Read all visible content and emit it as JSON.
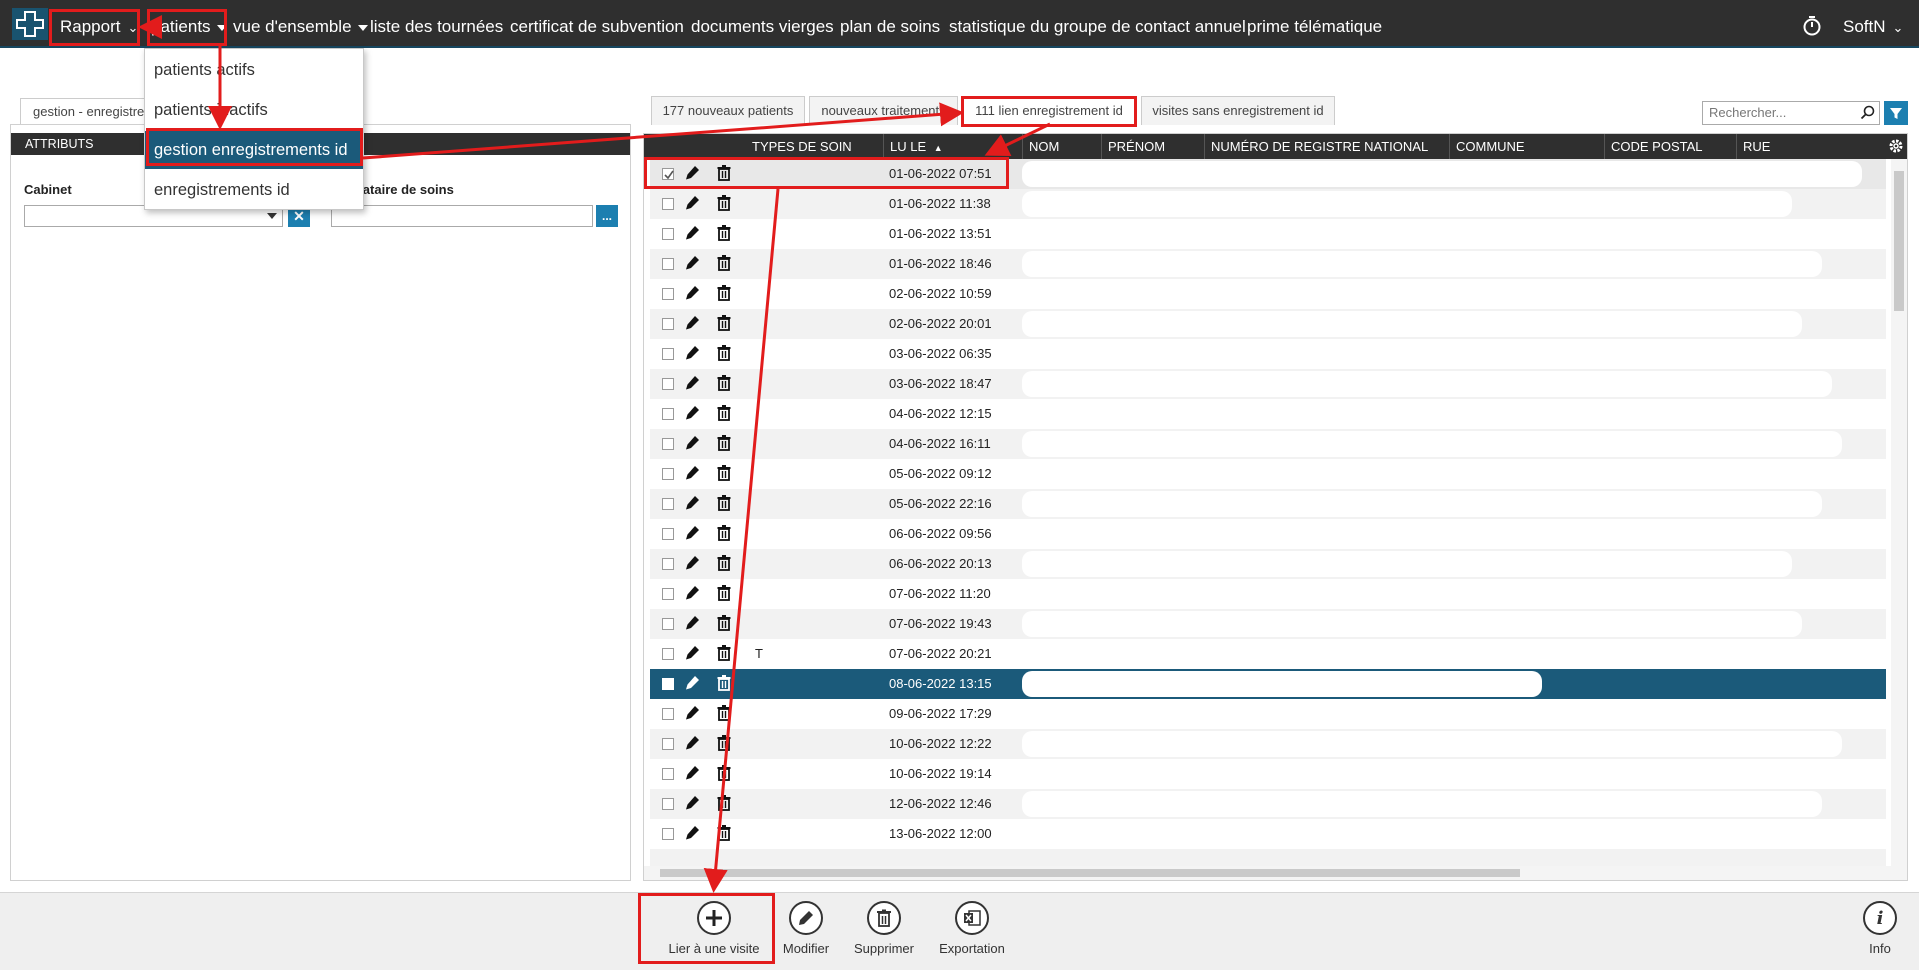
{
  "nav": {
    "rapport": "Rapport",
    "patients": "patients",
    "vue": "vue d'ensemble",
    "tournees": "liste des tournées",
    "certificat": "certificat de subvention",
    "documents": "documents vierges",
    "plan": "plan de soins",
    "statistique": "statistique du groupe de contact annuel",
    "prime": "prime télématique",
    "user": "SoftN"
  },
  "dropdown": {
    "items": [
      "patients actifs",
      "patients inactifs",
      "gestion enregistrements id",
      "enregistrements id"
    ]
  },
  "left": {
    "tab": "gestion - enregistre",
    "header": "ATTRIBUTS",
    "cabinet_label": "Cabinet",
    "prestataire_label": "prestataire de soins",
    "clear_btn": "✕",
    "dots_btn": "..."
  },
  "tabs": [
    "177 nouveaux patients",
    "nouveaux traitements",
    "111 lien enregistrement id",
    "visites sans enregistrement id"
  ],
  "search": {
    "placeholder": "Rechercher..."
  },
  "grid": {
    "columns": [
      "TYPES DE SOIN",
      "LU LE",
      "NOM",
      "PRÉNOM",
      "NUMÉRO DE REGISTRE NATIONAL",
      "COMMUNE",
      "CODE POSTAL",
      "RUE"
    ],
    "rows": [
      {
        "date": "01-06-2022 07:51",
        "type": "",
        "state": "checked"
      },
      {
        "date": "01-06-2022 11:38",
        "type": ""
      },
      {
        "date": "01-06-2022 13:51",
        "type": ""
      },
      {
        "date": "01-06-2022 18:46",
        "type": ""
      },
      {
        "date": "02-06-2022 10:59",
        "type": ""
      },
      {
        "date": "02-06-2022 20:01",
        "type": ""
      },
      {
        "date": "03-06-2022 06:35",
        "type": ""
      },
      {
        "date": "03-06-2022 18:47",
        "type": ""
      },
      {
        "date": "04-06-2022 12:15",
        "type": ""
      },
      {
        "date": "04-06-2022 16:11",
        "type": ""
      },
      {
        "date": "05-06-2022 09:12",
        "type": ""
      },
      {
        "date": "05-06-2022 22:16",
        "type": ""
      },
      {
        "date": "06-06-2022 09:56",
        "type": ""
      },
      {
        "date": "06-06-2022 20:13",
        "type": ""
      },
      {
        "date": "07-06-2022 11:20",
        "type": ""
      },
      {
        "date": "07-06-2022 19:43",
        "type": ""
      },
      {
        "date": "07-06-2022 20:21",
        "type": "T"
      },
      {
        "date": "08-06-2022 13:15",
        "type": "",
        "state": "selected"
      },
      {
        "date": "09-06-2022 17:29",
        "type": ""
      },
      {
        "date": "10-06-2022 12:22",
        "type": ""
      },
      {
        "date": "10-06-2022 19:14",
        "type": ""
      },
      {
        "date": "12-06-2022 12:46",
        "type": ""
      },
      {
        "date": "13-06-2022 12:00",
        "type": ""
      }
    ]
  },
  "toolbar": {
    "link": "Lier à une visite",
    "modify": "Modifier",
    "delete": "Supprimer",
    "export": "Exportation",
    "info": "Info"
  },
  "colors": {
    "nav_bg": "#2f2f2f",
    "accent": "#1b5a7a",
    "button_blue": "#1c7fb0",
    "annotation_red": "#e21c1c"
  }
}
